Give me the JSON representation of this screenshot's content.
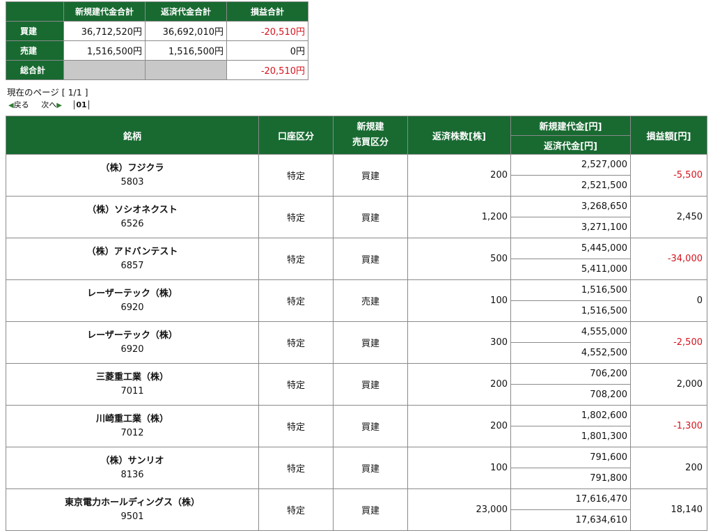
{
  "summary": {
    "headers": [
      "新規建代金合計",
      "返済代金合計",
      "損益合計"
    ],
    "rows": [
      {
        "label": "買建",
        "new_total": "36,712,520円",
        "close_total": "36,692,010円",
        "pl": "-20,510円",
        "negative": true
      },
      {
        "label": "売建",
        "new_total": "1,516,500円",
        "close_total": "1,516,500円",
        "pl": "0円",
        "negative": false
      },
      {
        "label": "総合計",
        "new_total": "",
        "close_total": "",
        "pl": "-20,510円",
        "negative": true
      }
    ]
  },
  "page_info": {
    "current_page_text": "現在のページ [ 1/1 ]",
    "back_label": "戻る",
    "next_label": "次へ",
    "page_link": "01"
  },
  "positions": {
    "headers": {
      "name": "銘柄",
      "account": "口座区分",
      "side_line1": "新規建",
      "side_line2": "売買区分",
      "qty": "返済株数[株]",
      "new_amount": "新規建代金[円]",
      "close_amount": "返済代金[円]",
      "pl": "損益額[円]"
    },
    "rows": [
      {
        "name": "（株）フジクラ",
        "code": "5803",
        "account": "特定",
        "side": "買建",
        "qty": "200",
        "new_amount": "2,527,000",
        "close_amount": "2,521,500",
        "pl": "-5,500",
        "negative": true
      },
      {
        "name": "（株）ソシオネクスト",
        "code": "6526",
        "account": "特定",
        "side": "買建",
        "qty": "1,200",
        "new_amount": "3,268,650",
        "close_amount": "3,271,100",
        "pl": "2,450",
        "negative": false
      },
      {
        "name": "（株）アドバンテスト",
        "code": "6857",
        "account": "特定",
        "side": "買建",
        "qty": "500",
        "new_amount": "5,445,000",
        "close_amount": "5,411,000",
        "pl": "-34,000",
        "negative": true
      },
      {
        "name": "レーザーテック（株）",
        "code": "6920",
        "account": "特定",
        "side": "売建",
        "qty": "100",
        "new_amount": "1,516,500",
        "close_amount": "1,516,500",
        "pl": "0",
        "negative": false
      },
      {
        "name": "レーザーテック（株）",
        "code": "6920",
        "account": "特定",
        "side": "買建",
        "qty": "300",
        "new_amount": "4,555,000",
        "close_amount": "4,552,500",
        "pl": "-2,500",
        "negative": true
      },
      {
        "name": "三菱重工業（株）",
        "code": "7011",
        "account": "特定",
        "side": "買建",
        "qty": "200",
        "new_amount": "706,200",
        "close_amount": "708,200",
        "pl": "2,000",
        "negative": false
      },
      {
        "name": "川崎重工業（株）",
        "code": "7012",
        "account": "特定",
        "side": "買建",
        "qty": "200",
        "new_amount": "1,802,600",
        "close_amount": "1,801,300",
        "pl": "-1,300",
        "negative": true
      },
      {
        "name": "（株）サンリオ",
        "code": "8136",
        "account": "特定",
        "side": "買建",
        "qty": "100",
        "new_amount": "791,600",
        "close_amount": "791,800",
        "pl": "200",
        "negative": false
      },
      {
        "name": "東京電力ホールディングス（株）",
        "code": "9501",
        "account": "特定",
        "side": "買建",
        "qty": "23,000",
        "new_amount": "17,616,470",
        "close_amount": "17,634,610",
        "pl": "18,140",
        "negative": false
      }
    ]
  },
  "colors": {
    "header_green": "#186a31",
    "negative_red": "#d4141d",
    "total_gray": "#c8c8c8"
  }
}
